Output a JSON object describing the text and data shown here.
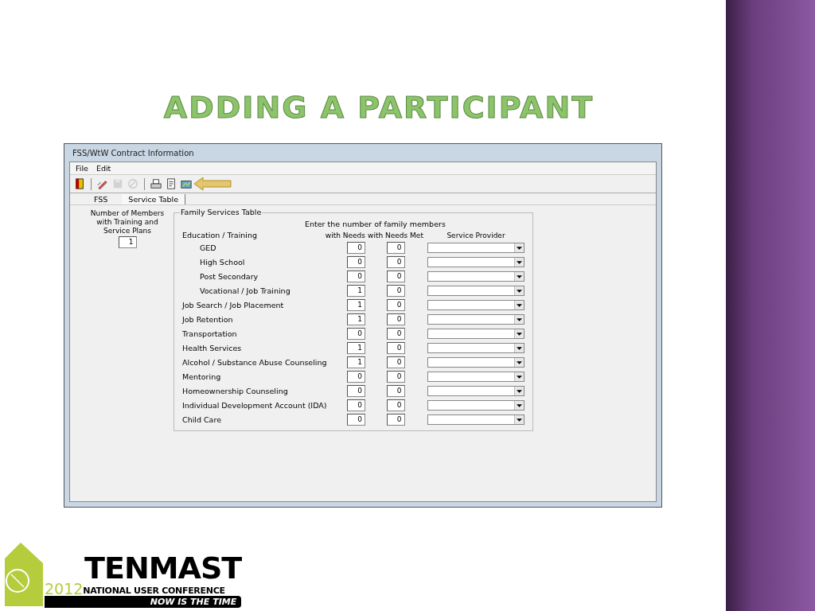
{
  "slide": {
    "title": "ADDING A PARTICIPANT"
  },
  "window": {
    "title": "FSS/WtW Contract Information",
    "menu": [
      "File",
      "Edit"
    ],
    "toolbar": [
      {
        "disabled": false
      },
      {
        "disabled": false
      },
      {
        "disabled": true
      },
      {
        "disabled": true
      },
      {
        "disabled": false
      },
      {
        "disabled": false
      },
      {
        "disabled": false
      }
    ],
    "tabs": [
      {
        "label": "FSS",
        "selected": false
      },
      {
        "label": "Service Table",
        "selected": true
      }
    ],
    "members": {
      "label": "Number of Members with Training and Service Plans",
      "value": "1"
    },
    "group": {
      "title": "Family Services Table",
      "header": "Enter the number of family members",
      "columns": [
        "with Needs",
        "with Needs Met",
        "Service Provider"
      ],
      "rows": [
        {
          "label": "Education / Training",
          "children": [
            {
              "label": "GED",
              "needs": "0",
              "met": "0"
            },
            {
              "label": "High School",
              "needs": "0",
              "met": "0"
            },
            {
              "label": "Post Secondary",
              "needs": "0",
              "met": "0"
            },
            {
              "label": "Vocational / Job Training",
              "needs": "1",
              "met": "0"
            }
          ]
        },
        {
          "label": "Job Search / Job Placement",
          "needs": "1",
          "met": "0"
        },
        {
          "label": "Job Retention",
          "needs": "1",
          "met": "0"
        },
        {
          "label": "Transportation",
          "needs": "0",
          "met": "0"
        },
        {
          "label": "Health Services",
          "needs": "1",
          "met": "0"
        },
        {
          "label": "Alcohol / Substance Abuse Counseling",
          "needs": "1",
          "met": "0"
        },
        {
          "label": "Mentoring",
          "needs": "0",
          "met": "0"
        },
        {
          "label": "Homeownership Counseling",
          "needs": "0",
          "met": "0"
        },
        {
          "label": "Individual Development Account (IDA)",
          "needs": "0",
          "met": "0"
        },
        {
          "label": "Child Care",
          "needs": "0",
          "met": "0"
        }
      ]
    }
  },
  "logo": {
    "name": "TENMAST",
    "year": "2012",
    "subtitle": "NATIONAL USER CONFERENCE",
    "tagline": "NOW IS THE TIME"
  }
}
